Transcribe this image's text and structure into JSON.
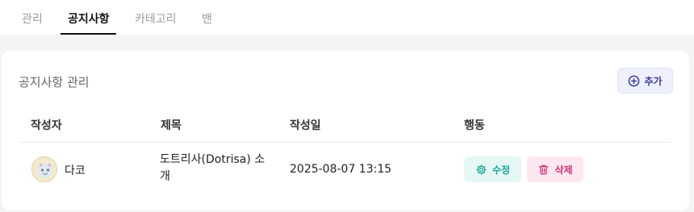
{
  "tabs": [
    {
      "label": "관리",
      "active": false
    },
    {
      "label": "공지사항",
      "active": true
    },
    {
      "label": "카테고리",
      "active": false
    },
    {
      "label": "밴",
      "active": false
    }
  ],
  "card": {
    "title": "공지사항 관리",
    "add_label": "추가"
  },
  "table": {
    "headers": [
      "작성자",
      "제목",
      "작성일",
      "행동"
    ],
    "rows": [
      {
        "author": "다코",
        "title": "도트리사(Dotrisa) 소개",
        "date": "2025-08-07 13:15",
        "edit_label": "수정",
        "delete_label": "삭제"
      }
    ]
  },
  "colors": {
    "accent": "#3a3f9a",
    "edit": "#1aa79a",
    "delete": "#d6337a"
  },
  "icons": {
    "add": "plus-circle-icon",
    "edit": "gear-icon",
    "delete": "trash-icon"
  }
}
